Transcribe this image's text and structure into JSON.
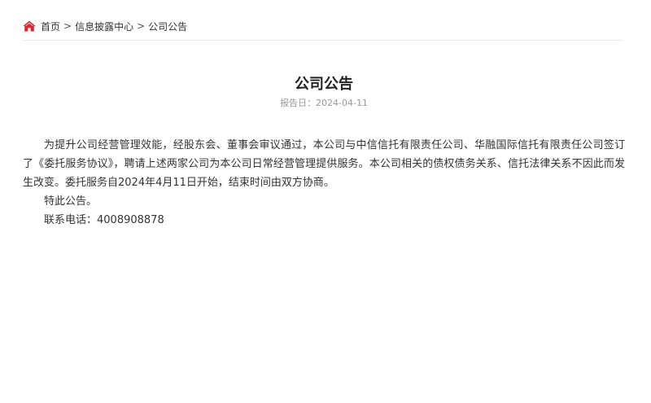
{
  "breadcrumb": {
    "home": "首页",
    "separator": ">",
    "section": "信息披露中心",
    "current": "公司公告"
  },
  "article": {
    "title": "公司公告",
    "date_label": "报告日：",
    "date": "2024-04-11",
    "paragraphs": [
      "为提升公司经营管理效能，经股东会、董事会审议通过，本公司与中信信托有限责任公司、华融国际信托有限责任公司签订了《委托服务协议》，聘请上述两家公司为本公司日常经营管理提供服务。本公司相关的债权债务关系、信托法律关系不因此而发生改变。委托服务自2024年4月11日开始，结束时间由双方协商。",
      "特此公告。",
      "联系电话：4008908878"
    ]
  },
  "colors": {
    "home_icon": "#d9262c",
    "text": "#333333",
    "muted": "#999999",
    "divider": "#e6e6e6"
  }
}
